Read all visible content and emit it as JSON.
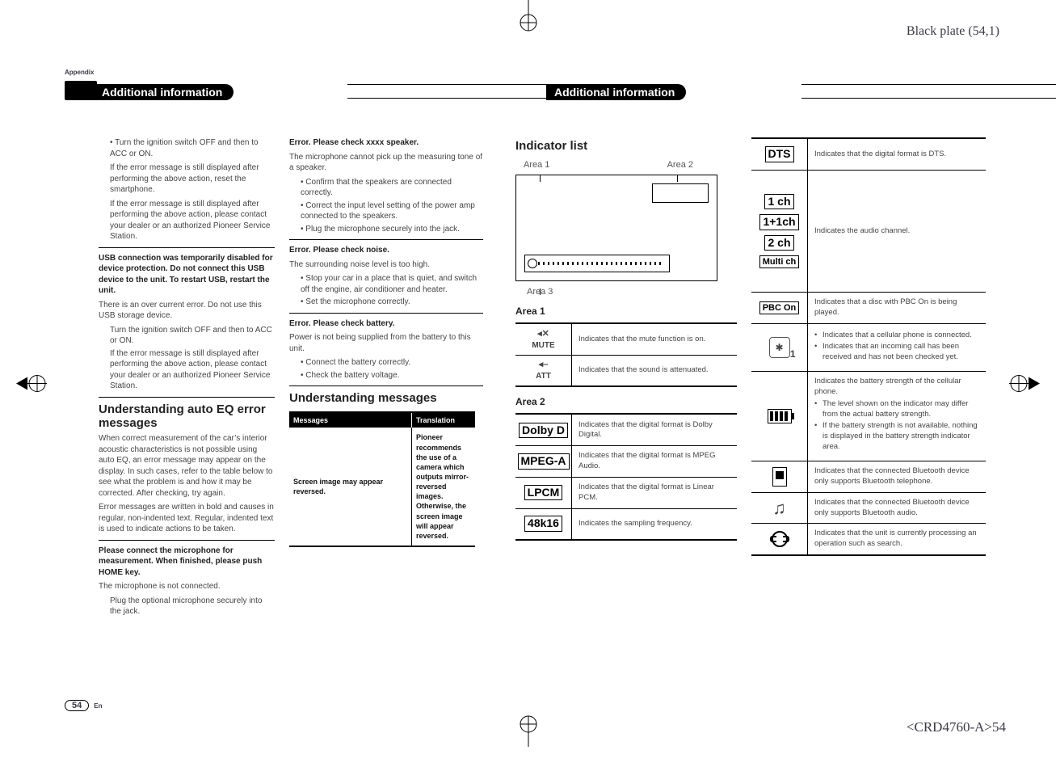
{
  "meta": {
    "black_plate": "Black plate (54,1)",
    "appendix": "Appendix",
    "page_number": "54",
    "page_lang": "En",
    "doc_code": "<CRD4760-A>54"
  },
  "headers": {
    "left": "Additional information",
    "right": "Additional information"
  },
  "col1": {
    "p1": "• Turn the ignition switch OFF and then to ACC or ON.",
    "p2": "If the error message is still displayed after performing the above action, reset the smartphone.",
    "p3": "If the error message is still displayed after performing the above action, please contact your dealer or an authorized Pioneer Service Station.",
    "usb_title": "USB connection was temporarily disabled for device protection. Do not connect this USB device to the unit. To restart USB, restart the unit.",
    "usb_p1": "There is an over current error. Do not use this USB storage device.",
    "usb_b1": "Turn the ignition switch OFF and then to ACC or ON.",
    "usb_b2": "If the error message is still displayed after performing the above action, please contact your dealer or an authorized Pioneer Service Station.",
    "h_autoeq": "Understanding auto EQ error messages",
    "autoeq_p": "When correct measurement of the car’s interior acoustic characteristics is not possible using auto EQ, an error message may appear on the display. In such cases, refer to the table below to see what the problem is and how it may be corrected. After checking, try again.",
    "autoeq_p2": "Error messages are written in bold and causes in regular, non-indented text. Regular, indented text is used to indicate actions to be taken.",
    "mic_title": "Please connect the microphone for measurement. When finished, please push HOME key.",
    "mic_p": "The microphone is not connected.",
    "mic_b1": "Plug the optional microphone securely into the jack."
  },
  "col2": {
    "spk_title": "Error. Please check xxxx speaker.",
    "spk_p": "The microphone cannot pick up the measuring tone of a speaker.",
    "spk_b1": "• Confirm that the speakers are connected correctly.",
    "spk_b2": "• Correct the input level setting of the power amp connected to the speakers.",
    "spk_b3": "• Plug the microphone securely into the jack.",
    "noise_title": "Error. Please check noise.",
    "noise_p": "The surrounding noise level is too high.",
    "noise_b1": "• Stop your car in a place that is quiet, and switch off the engine, air conditioner and heater.",
    "noise_b2": "• Set the microphone correctly.",
    "batt_title": "Error. Please check battery.",
    "batt_p": "Power is not being supplied from the battery to this unit.",
    "batt_b1": "• Connect the battery correctly.",
    "batt_b2": "• Check the battery voltage.",
    "h_msg": "Understanding messages",
    "tbl_h1": "Messages",
    "tbl_h2": "Translation",
    "tbl_r_msg": "Screen image may appear reversed.",
    "tbl_r_trans": "Pioneer recommends the use of a camera which outputs mirror-reversed images. Otherwise, the screen image will appear reversed."
  },
  "col3": {
    "h_ind": "Indicator list",
    "area1_lbl": "Area 1",
    "area2_lbl": "Area 2",
    "area3_lbl": "Area 3",
    "a1_h": "Area 1",
    "a1": [
      {
        "sym_top": "◂✕",
        "sym_bot": "MUTE",
        "desc": "Indicates that the mute function is on."
      },
      {
        "sym_top": "◂–",
        "sym_bot": "ATT",
        "desc": "Indicates that the sound is attenuated."
      }
    ],
    "a2_h": "Area 2",
    "a2": [
      {
        "box": "Dolby D",
        "desc": "Indicates that the digital format is Dolby Digital."
      },
      {
        "box": "MPEG-A",
        "desc": "Indicates that the digital format is MPEG Audio."
      },
      {
        "box": "LPCM",
        "desc": "Indicates that the digital format is Linear PCM."
      },
      {
        "box": "48k16",
        "desc": "Indicates the sampling frequency."
      }
    ]
  },
  "col4": {
    "rows": [
      {
        "kind": "box",
        "label": "DTS",
        "desc": "Indicates that the digital format is DTS."
      },
      {
        "kind": "chstack",
        "labels": [
          "1 ch",
          "1+1ch",
          "2 ch",
          "Multi ch"
        ],
        "desc": "Indicates the audio channel."
      },
      {
        "kind": "box",
        "label": "PBC On",
        "desc": "Indicates that a disc with PBC On is being played."
      },
      {
        "kind": "bt",
        "descblock": true,
        "desc_pre": "",
        "bullets": [
          "Indicates that a cellular phone is connected.",
          "Indicates that an incoming call has been received and has not been checked yet."
        ]
      },
      {
        "kind": "batt",
        "desc_pre": "Indicates the battery strength of the cellular phone.",
        "bullets": [
          "The level shown on the indicator may differ from the actual battery strength.",
          "If the battery strength is not available, nothing is displayed in the battery strength indicator area."
        ]
      },
      {
        "kind": "dev",
        "desc": "Indicates that the connected Bluetooth device only supports Bluetooth telephone."
      },
      {
        "kind": "music",
        "desc": "Indicates that the connected Bluetooth device only supports Bluetooth audio."
      },
      {
        "kind": "search",
        "desc": "Indicates that the unit is currently processing an operation such as search."
      }
    ]
  }
}
